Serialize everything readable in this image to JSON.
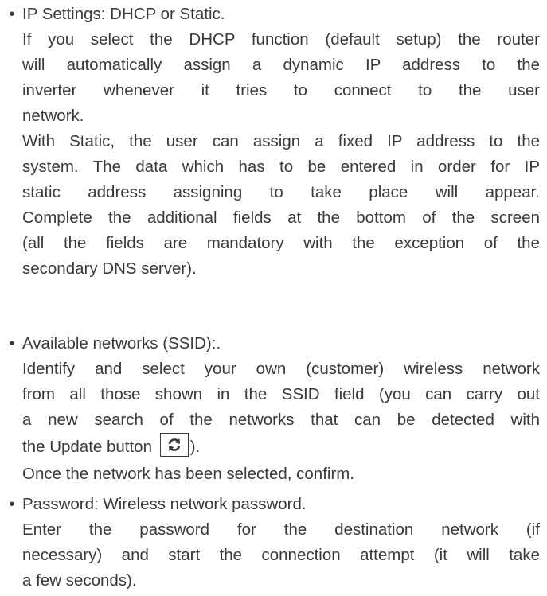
{
  "ip_settings": {
    "bullet": "•",
    "lines": [
      "IP Settings: DHCP or Static.",
      "If you select the DHCP function (default setup) the router",
      "will automatically assign a dynamic IP address to the",
      "inverter whenever it tries to connect to the user",
      "network.",
      "With Static, the user can assign a fixed IP address to the",
      "system. The data which has to be entered in order for IP",
      "static address assigning to take place will appear.",
      "Complete the additional fields at the bottom of the screen",
      "(all the fields are mandatory with the exception of the",
      "secondary DNS server)."
    ]
  },
  "available_networks": {
    "bullet": "•",
    "lines": [
      "Available networks (SSID):.",
      "Identify and select your own (customer) wireless network",
      "from all those shown in the SSID field (you can carry out",
      "a new search of the networks that can be detected with"
    ],
    "update_prefix": "the Update button",
    "update_suffix": ").",
    "update_icon": "refresh-icon",
    "confirm_line": "Once the network has been selected, confirm."
  },
  "password": {
    "bullet": "•",
    "lines": [
      "Password: Wireless network password.",
      "Enter the password for the destination network (if",
      "necessary) and start the connection attempt (it will take",
      "a few seconds)."
    ]
  }
}
